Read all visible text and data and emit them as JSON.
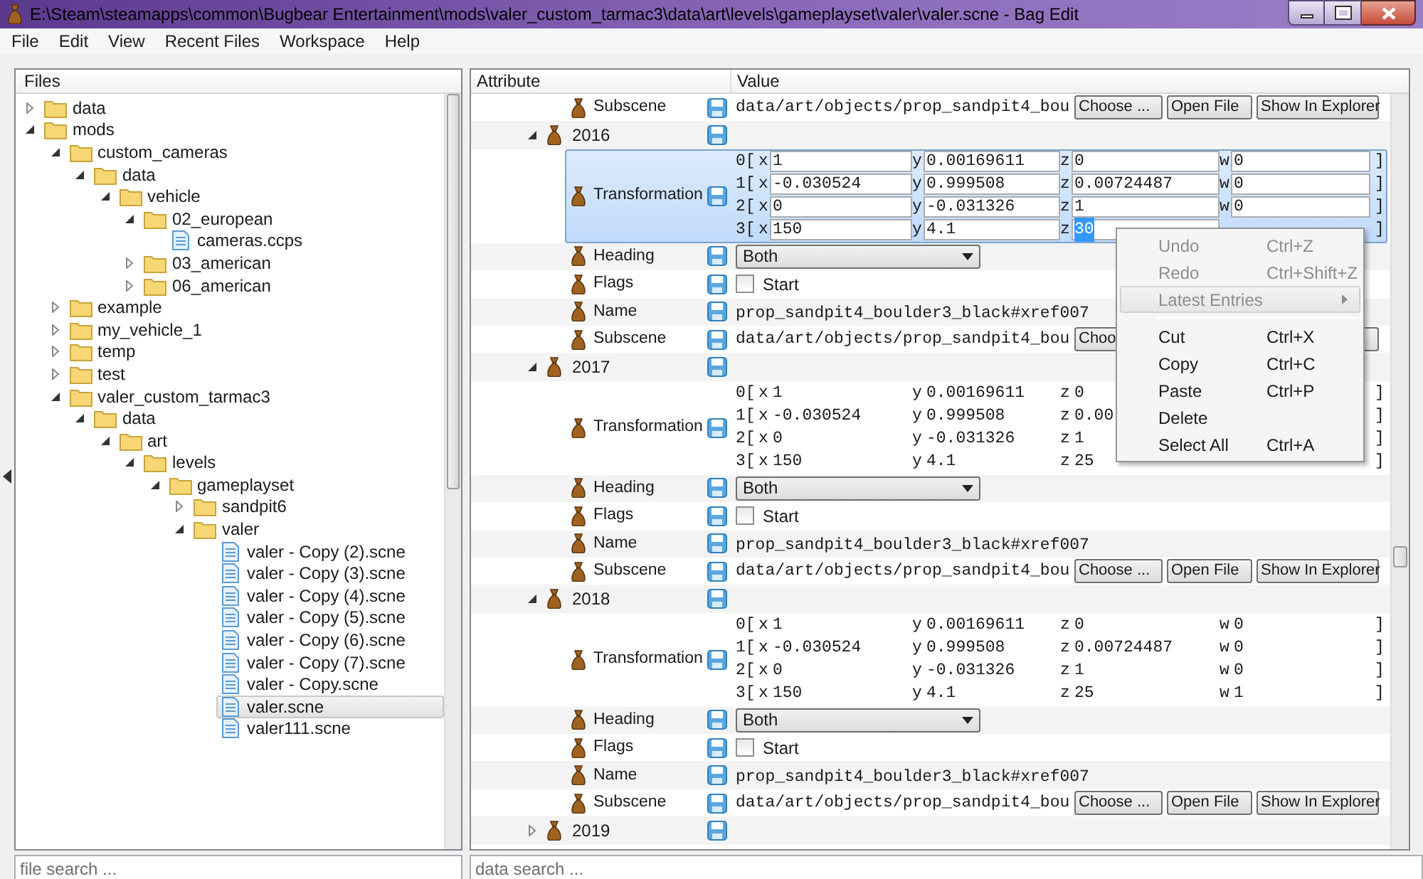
{
  "window": {
    "title": "E:\\Steam\\steamapps\\common\\Bugbear Entertainment\\mods\\valer_custom_tarmac3\\data\\art\\levels\\gameplayset\\valer\\valer.scne - Bag Edit"
  },
  "menu": [
    "File",
    "Edit",
    "View",
    "Recent Files",
    "Workspace",
    "Help"
  ],
  "files_panel": {
    "title": "Files",
    "tree": [
      {
        "kind": "folder",
        "label": "data",
        "expanded": false,
        "selected": false
      },
      {
        "kind": "folder",
        "label": "mods",
        "expanded": true,
        "selected": false,
        "children": [
          {
            "kind": "folder",
            "label": "custom_cameras",
            "expanded": true,
            "selected": false,
            "children": [
              {
                "kind": "folder",
                "label": "data",
                "expanded": true,
                "selected": false,
                "children": [
                  {
                    "kind": "folder",
                    "label": "vehicle",
                    "expanded": true,
                    "selected": false,
                    "children": [
                      {
                        "kind": "folder",
                        "label": "02_european",
                        "expanded": true,
                        "selected": false,
                        "children": [
                          {
                            "kind": "file",
                            "label": "cameras.ccps",
                            "selected": false
                          }
                        ]
                      },
                      {
                        "kind": "folder",
                        "label": "03_american",
                        "expanded": false,
                        "selected": false
                      },
                      {
                        "kind": "folder",
                        "label": "06_american",
                        "expanded": false,
                        "selected": false
                      }
                    ]
                  }
                ]
              }
            ]
          },
          {
            "kind": "folder",
            "label": "example",
            "expanded": false,
            "selected": false
          },
          {
            "kind": "folder",
            "label": "my_vehicle_1",
            "expanded": false,
            "selected": false
          },
          {
            "kind": "folder",
            "label": "temp",
            "expanded": false,
            "selected": false
          },
          {
            "kind": "folder",
            "label": "test",
            "expanded": false,
            "selected": false
          },
          {
            "kind": "folder",
            "label": "valer_custom_tarmac3",
            "expanded": true,
            "selected": false,
            "children": [
              {
                "kind": "folder",
                "label": "data",
                "expanded": true,
                "selected": false,
                "children": [
                  {
                    "kind": "folder",
                    "label": "art",
                    "expanded": true,
                    "selected": false,
                    "children": [
                      {
                        "kind": "folder",
                        "label": "levels",
                        "expanded": true,
                        "selected": false,
                        "children": [
                          {
                            "kind": "folder",
                            "label": "gameplayset",
                            "expanded": true,
                            "selected": false,
                            "children": [
                              {
                                "kind": "folder",
                                "label": "sandpit6",
                                "expanded": false,
                                "selected": false
                              },
                              {
                                "kind": "folder",
                                "label": "valer",
                                "expanded": true,
                                "selected": false,
                                "children": [
                                  {
                                    "kind": "file",
                                    "label": "valer - Copy (2).scne",
                                    "selected": false
                                  },
                                  {
                                    "kind": "file",
                                    "label": "valer - Copy (3).scne",
                                    "selected": false
                                  },
                                  {
                                    "kind": "file",
                                    "label": "valer - Copy (4).scne",
                                    "selected": false
                                  },
                                  {
                                    "kind": "file",
                                    "label": "valer - Copy (5).scne",
                                    "selected": false
                                  },
                                  {
                                    "kind": "file",
                                    "label": "valer - Copy (6).scne",
                                    "selected": false
                                  },
                                  {
                                    "kind": "file",
                                    "label": "valer - Copy (7).scne",
                                    "selected": false
                                  },
                                  {
                                    "kind": "file",
                                    "label": "valer - Copy.scne",
                                    "selected": false
                                  },
                                  {
                                    "kind": "file",
                                    "label": "valer.scne",
                                    "selected": true
                                  },
                                  {
                                    "kind": "file",
                                    "label": "valer111.scne",
                                    "selected": false
                                  }
                                ]
                              }
                            ]
                          }
                        ]
                      }
                    ]
                  }
                ]
              }
            ]
          }
        ]
      }
    ]
  },
  "file_search": {
    "placeholder": "file search ..."
  },
  "data_panel": {
    "columns": [
      "Attribute",
      "Value"
    ],
    "rows": [
      {
        "kind": "subscene",
        "label": "Subscene",
        "selected": false,
        "path": "data/art/objects/prop_sandpit4_bou",
        "buttons": [
          {
            "kind": "button",
            "label": "Choose ..."
          },
          {
            "kind": "button",
            "label": "Open File"
          },
          {
            "kind": "button",
            "label": "Show In Explorer"
          }
        ]
      },
      {
        "kind": "group",
        "label": "2016",
        "expanded": true,
        "selected": false,
        "children": [
          {
            "kind": "transformation",
            "label": "Transformation",
            "selected": true,
            "editing": true,
            "matrix": [
              {
                "open": "0[",
                "close": "]",
                "cells": [
                  {
                    "axis": "x",
                    "value": "1",
                    "selected": false
                  },
                  {
                    "axis": "y",
                    "value": "0.00169611",
                    "selected": false
                  },
                  {
                    "axis": "z",
                    "value": "0",
                    "selected": false
                  },
                  {
                    "axis": "w",
                    "value": "0",
                    "selected": false
                  }
                ]
              },
              {
                "open": "1[",
                "close": "]",
                "cells": [
                  {
                    "axis": "x",
                    "value": "-0.030524",
                    "selected": false
                  },
                  {
                    "axis": "y",
                    "value": "0.999508",
                    "selected": false
                  },
                  {
                    "axis": "z",
                    "value": "0.00724487",
                    "selected": false
                  },
                  {
                    "axis": "w",
                    "value": "0",
                    "selected": false
                  }
                ]
              },
              {
                "open": "2[",
                "close": "]",
                "cells": [
                  {
                    "axis": "x",
                    "value": "0",
                    "selected": false
                  },
                  {
                    "axis": "y",
                    "value": "-0.031326",
                    "selected": false
                  },
                  {
                    "axis": "z",
                    "value": "1",
                    "selected": false
                  },
                  {
                    "axis": "w",
                    "value": "0",
                    "selected": false
                  }
                ]
              },
              {
                "open": "3[",
                "close": "]",
                "cells": [
                  {
                    "axis": "x",
                    "value": "150",
                    "selected": false
                  },
                  {
                    "axis": "y",
                    "value": "4.1",
                    "selected": false
                  },
                  {
                    "axis": "z",
                    "value": "30",
                    "selected": true
                  }
                ]
              }
            ]
          },
          {
            "kind": "heading",
            "label": "Heading",
            "selected": false,
            "value": "Both"
          },
          {
            "kind": "flags",
            "label": "Flags",
            "selected": false,
            "option": "Start",
            "checked": false
          },
          {
            "kind": "name",
            "label": "Name",
            "selected": false,
            "value": "prop_sandpit4_boulder3_black#xref007"
          },
          {
            "kind": "subscene",
            "label": "Subscene",
            "selected": false,
            "path": "data/art/objects/prop_sandpit4_bou",
            "buttons": [
              {
                "kind": "button",
                "label": "Choo"
              },
              {
                "kind": "hidden"
              },
              {
                "kind": "covered"
              }
            ]
          }
        ]
      },
      {
        "kind": "group",
        "label": "2017",
        "expanded": true,
        "selected": false,
        "children": [
          {
            "kind": "transformation",
            "label": "Transformation",
            "selected": false,
            "editing": false,
            "matrix": [
              {
                "open": "0[",
                "close": "]",
                "cells": [
                  {
                    "axis": "x",
                    "value": "1",
                    "selected": false
                  },
                  {
                    "axis": "y",
                    "value": "0.00169611",
                    "selected": false
                  },
                  {
                    "axis": "z",
                    "value": "0",
                    "selected": false
                  }
                ]
              },
              {
                "open": "1[",
                "close": "]",
                "cells": [
                  {
                    "axis": "x",
                    "value": "-0.030524",
                    "selected": false
                  },
                  {
                    "axis": "y",
                    "value": "0.999508",
                    "selected": false
                  },
                  {
                    "axis": "z",
                    "value": "0.00",
                    "selected": false
                  }
                ]
              },
              {
                "open": "2[",
                "close": "]",
                "cells": [
                  {
                    "axis": "x",
                    "value": "0",
                    "selected": false
                  },
                  {
                    "axis": "y",
                    "value": "-0.031326",
                    "selected": false
                  },
                  {
                    "axis": "z",
                    "value": "1",
                    "selected": false
                  }
                ]
              },
              {
                "open": "3[",
                "close": "]",
                "cells": [
                  {
                    "axis": "x",
                    "value": "150",
                    "selected": false
                  },
                  {
                    "axis": "y",
                    "value": "4.1",
                    "selected": false
                  },
                  {
                    "axis": "z",
                    "value": "25",
                    "selected": false
                  }
                ]
              }
            ]
          },
          {
            "kind": "heading",
            "label": "Heading",
            "selected": false,
            "value": "Both"
          },
          {
            "kind": "flags",
            "label": "Flags",
            "selected": false,
            "option": "Start",
            "checked": false
          },
          {
            "kind": "name",
            "label": "Name",
            "selected": false,
            "value": "prop_sandpit4_boulder3_black#xref007"
          },
          {
            "kind": "subscene",
            "label": "Subscene",
            "selected": false,
            "path": "data/art/objects/prop_sandpit4_bou",
            "buttons": [
              {
                "kind": "button",
                "label": "Choose ..."
              },
              {
                "kind": "button",
                "label": "Open File"
              },
              {
                "kind": "button",
                "label": "Show In Explorer"
              }
            ]
          }
        ]
      },
      {
        "kind": "group",
        "label": "2018",
        "expanded": true,
        "selected": false,
        "children": [
          {
            "kind": "transformation",
            "label": "Transformation",
            "selected": false,
            "editing": false,
            "matrix": [
              {
                "open": "0[",
                "close": "]",
                "cells": [
                  {
                    "axis": "x",
                    "value": "1",
                    "selected": false
                  },
                  {
                    "axis": "y",
                    "value": "0.00169611",
                    "selected": false
                  },
                  {
                    "axis": "z",
                    "value": "0",
                    "selected": false
                  },
                  {
                    "axis": "w",
                    "value": "0",
                    "selected": false
                  }
                ]
              },
              {
                "open": "1[",
                "close": "]",
                "cells": [
                  {
                    "axis": "x",
                    "value": "-0.030524",
                    "selected": false
                  },
                  {
                    "axis": "y",
                    "value": "0.999508",
                    "selected": false
                  },
                  {
                    "axis": "z",
                    "value": "0.00724487",
                    "selected": false
                  },
                  {
                    "axis": "w",
                    "value": "0",
                    "selected": false
                  }
                ]
              },
              {
                "open": "2[",
                "close": "]",
                "cells": [
                  {
                    "axis": "x",
                    "value": "0",
                    "selected": false
                  },
                  {
                    "axis": "y",
                    "value": "-0.031326",
                    "selected": false
                  },
                  {
                    "axis": "z",
                    "value": "1",
                    "selected": false
                  },
                  {
                    "axis": "w",
                    "value": "0",
                    "selected": false
                  }
                ]
              },
              {
                "open": "3[",
                "close": "]",
                "cells": [
                  {
                    "axis": "x",
                    "value": "150",
                    "selected": false
                  },
                  {
                    "axis": "y",
                    "value": "4.1",
                    "selected": false
                  },
                  {
                    "axis": "z",
                    "value": "25",
                    "selected": false
                  },
                  {
                    "axis": "w",
                    "value": "1",
                    "selected": false
                  }
                ]
              }
            ]
          },
          {
            "kind": "heading",
            "label": "Heading",
            "selected": false,
            "value": "Both"
          },
          {
            "kind": "flags",
            "label": "Flags",
            "selected": false,
            "option": "Start",
            "checked": false
          },
          {
            "kind": "name",
            "label": "Name",
            "selected": false,
            "value": "prop_sandpit4_boulder3_black#xref007"
          },
          {
            "kind": "subscene",
            "label": "Subscene",
            "selected": false,
            "path": "data/art/objects/prop_sandpit4_bou",
            "buttons": [
              {
                "kind": "button",
                "label": "Choose ..."
              },
              {
                "kind": "button",
                "label": "Open File"
              },
              {
                "kind": "button",
                "label": "Show In Explorer"
              }
            ]
          }
        ]
      },
      {
        "kind": "group",
        "label": "2019",
        "expanded": false,
        "selected": false
      }
    ]
  },
  "data_search": {
    "placeholder": "data search ..."
  },
  "context_menu": {
    "items": [
      {
        "kind": "item",
        "label": "Undo",
        "shortcut": "Ctrl+Z",
        "disabled": true,
        "highlighted": false
      },
      {
        "kind": "item",
        "label": "Redo",
        "shortcut": "Ctrl+Shift+Z",
        "disabled": true,
        "highlighted": false
      },
      {
        "kind": "submenu",
        "label": "Latest Entries",
        "disabled": true,
        "highlighted": true
      },
      {
        "kind": "separator"
      },
      {
        "kind": "item",
        "label": "Cut",
        "shortcut": "Ctrl+X",
        "disabled": false,
        "highlighted": false
      },
      {
        "kind": "item",
        "label": "Copy",
        "shortcut": "Ctrl+C",
        "disabled": false,
        "highlighted": false
      },
      {
        "kind": "item",
        "label": "Paste",
        "shortcut": "Ctrl+P",
        "disabled": false,
        "highlighted": false
      },
      {
        "kind": "item",
        "label": "Delete",
        "disabled": false,
        "highlighted": false
      },
      {
        "kind": "item",
        "label": "Select All",
        "shortcut": "Ctrl+A",
        "disabled": false,
        "highlighted": false
      }
    ]
  }
}
